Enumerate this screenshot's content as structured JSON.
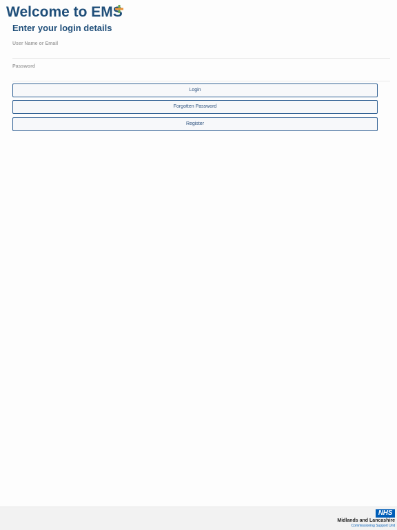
{
  "header": {
    "title": "Welcome to EMS",
    "subtitle": "Enter your login details"
  },
  "form": {
    "username_label": "User Name or Email",
    "username_value": "",
    "password_label": "Password",
    "password_value": "",
    "login_label": "Login",
    "forgot_label": "Forgotten Password",
    "register_label": "Register"
  },
  "footer": {
    "logo_text": "NHS",
    "org_name": "Midlands and Lancashire",
    "org_subtitle": "Commissioning Support Unit"
  },
  "colors": {
    "brand_blue": "#1f4e79",
    "nhs_blue": "#005eb8",
    "plus_green": "#6aa84f",
    "plus_orange": "#e69138"
  },
  "icons": {
    "title_mark": "plus-icon"
  }
}
